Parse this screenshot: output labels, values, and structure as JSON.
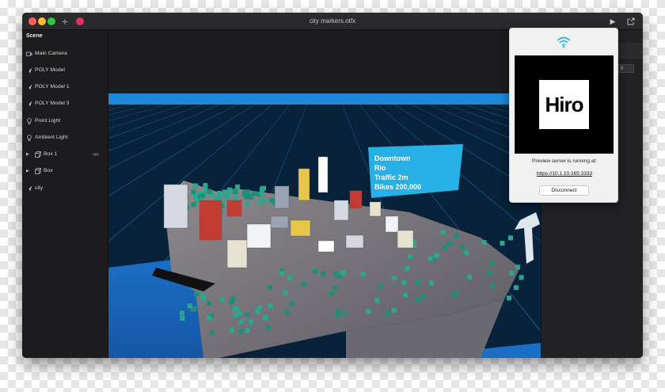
{
  "window": {
    "title": "city markers.otfx"
  },
  "scene": {
    "heading": "Scene",
    "items": [
      {
        "label": "Main Camera",
        "icon": "camera-icon",
        "expandable": false
      },
      {
        "label": "POLY Model",
        "icon": "poly-model-icon",
        "expandable": false
      },
      {
        "label": "POLY Model 1",
        "icon": "poly-model-icon",
        "expandable": false
      },
      {
        "label": "POLY Model 3",
        "icon": "poly-model-icon",
        "expandable": false
      },
      {
        "label": "Point Light",
        "icon": "bulb-icon",
        "expandable": false
      },
      {
        "label": "Ambient Light",
        "icon": "bulb-icon",
        "expandable": false
      },
      {
        "label": "Box 1",
        "icon": "box-icon",
        "expandable": true,
        "linked": true
      },
      {
        "label": "Box",
        "icon": "box-icon",
        "expandable": true
      },
      {
        "label": "city",
        "icon": "poly-model-icon",
        "expandable": false
      }
    ]
  },
  "viewport": {
    "billboard_lines": [
      "Downtown",
      "Rio",
      "Traffic 2m",
      "Bikes 200,000"
    ]
  },
  "inspector": {
    "number_value": "0",
    "accent_color": "#1fb6e8"
  },
  "preview": {
    "marker_text": "Hiro",
    "message": "Preview server is running at:",
    "url": "https://10.1.10.165:3333",
    "disconnect_label": "Disconnect"
  },
  "colors": {
    "brand": "#e0325e",
    "grid": "#2fa8e6",
    "water": "#1a6fc4"
  }
}
